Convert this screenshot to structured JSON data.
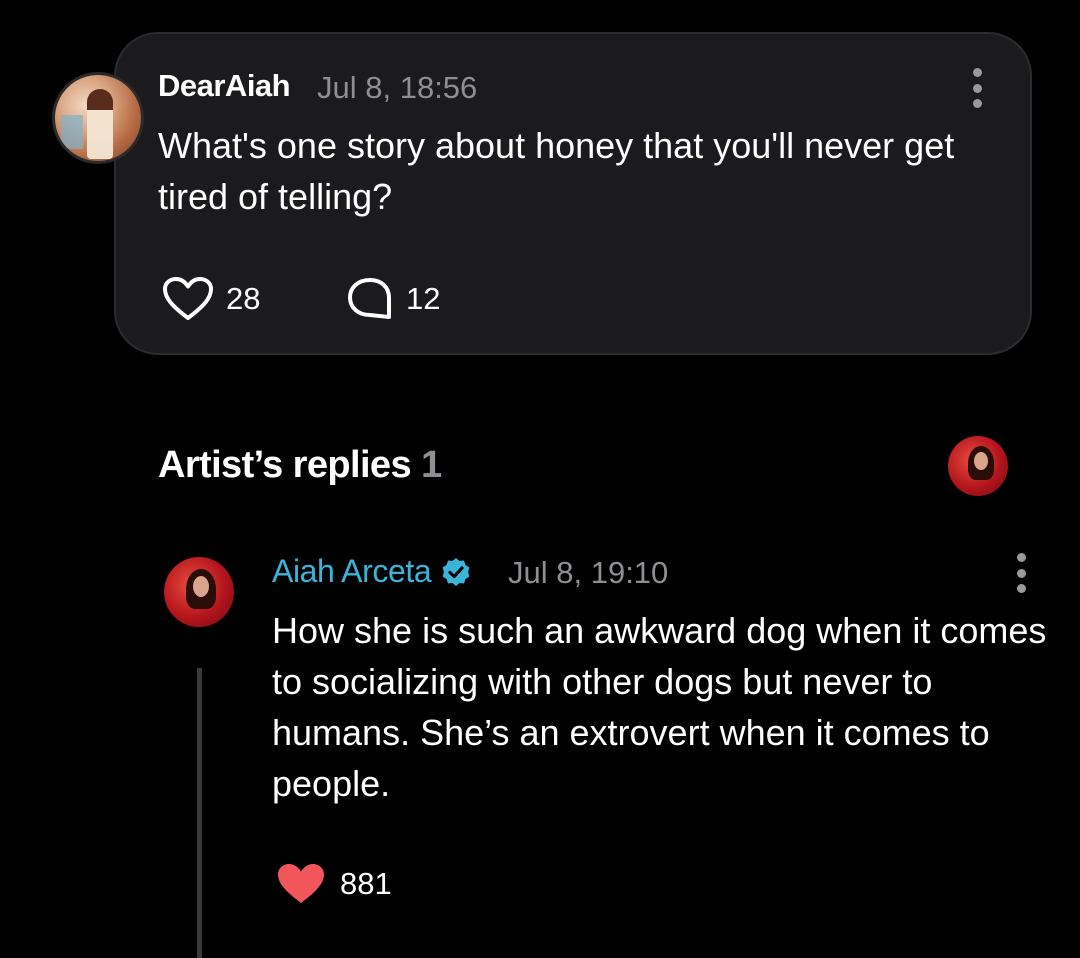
{
  "post": {
    "username": "DearAiah",
    "time": "Jul 8, 18:56",
    "text": "What's one story about honey that you'll never get tired of telling?",
    "likes": "28",
    "comments": "12"
  },
  "replies_section": {
    "title": "Artist’s replies",
    "count": "1"
  },
  "reply": {
    "author": "Aiah Arceta",
    "time": "Jul 8, 19:10",
    "text": "How she is such an awkward dog when it comes to socializing with other dogs but never to humans. She’s an extrovert when it comes to people.",
    "likes": "881"
  },
  "colors": {
    "background": "#000000",
    "card": "#1b1b1d",
    "artist_name": "#3bb4d9",
    "liked_heart": "#f2555a",
    "muted_text": "#8e8e93"
  },
  "icons": {
    "like": "heart-outline-icon",
    "comment": "speech-bubble-icon",
    "more": "vertical-ellipsis-icon",
    "verified": "verified-badge-icon",
    "liked": "heart-filled-icon"
  }
}
